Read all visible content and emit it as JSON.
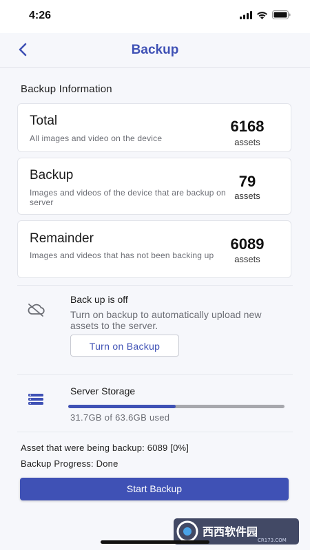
{
  "status_bar": {
    "time": "4:26"
  },
  "header": {
    "title": "Backup"
  },
  "backup_info": {
    "section_title": "Backup Information",
    "total": {
      "title": "Total",
      "description": "All images and video on the device",
      "count": "6168",
      "unit": "assets"
    },
    "backup": {
      "title": "Backup",
      "description": "Images and videos of the device that are backup on server",
      "count": "79",
      "unit": "assets"
    },
    "remainder": {
      "title": "Remainder",
      "description": "Images and videos that has not been backing up",
      "count": "6089",
      "unit": "assets"
    }
  },
  "auto_backup": {
    "title": "Back up is off",
    "description": "Turn on backup to automatically upload new assets to the server.",
    "button_label": "Turn on Backup"
  },
  "server_storage": {
    "title": "Server Storage",
    "used_label": "31.7GB of 63.6GB used",
    "used_fraction": 0.4984
  },
  "progress": {
    "assets_line": "Asset that were being backup: 6089 [0%]",
    "status_line": "Backup Progress: Done"
  },
  "start_button_label": "Start Backup",
  "watermark": {
    "text": "西西软件园",
    "subtext": "CR173.COM"
  },
  "colors": {
    "accent": "#3f51b5",
    "background": "#f6f7fb",
    "muted_text": "#6b6d74",
    "track": "#a7a8ad"
  }
}
